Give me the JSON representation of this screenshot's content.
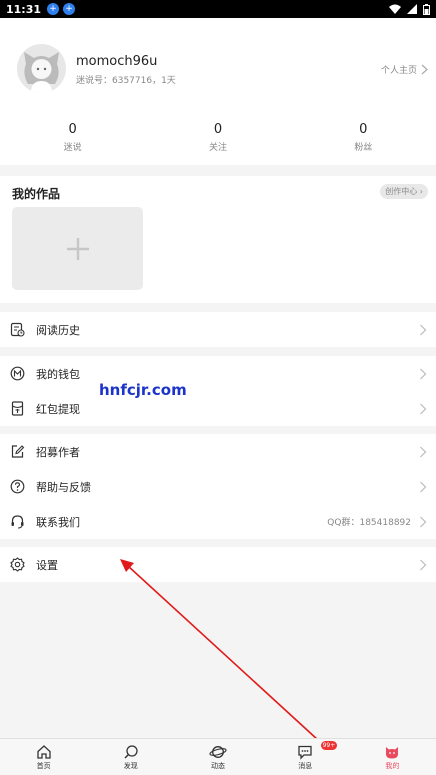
{
  "status": {
    "time": "11:31"
  },
  "profile": {
    "username": "momoch96u",
    "user_id": "迷说号：6357716，1天",
    "homepage_label": "个人主页",
    "stats": [
      {
        "value": "0",
        "label": "迷说"
      },
      {
        "value": "0",
        "label": "关注"
      },
      {
        "value": "0",
        "label": "粉丝"
      }
    ]
  },
  "works": {
    "title": "我的作品",
    "create_center": "创作中心"
  },
  "menu": {
    "reading_history": "阅读历史",
    "wallet": "我的钱包",
    "redpacket": "红包提现",
    "recruit": "招募作者",
    "help": "帮助与反馈",
    "contact": "联系我们",
    "contact_qq": "QQ群：185418892",
    "settings": "设置"
  },
  "watermark": "hnfcjr.com",
  "tabs": [
    {
      "label": "首页",
      "icon": "home-icon"
    },
    {
      "label": "发现",
      "icon": "discover-icon"
    },
    {
      "label": "动态",
      "icon": "planet-icon"
    },
    {
      "label": "消息",
      "icon": "message-icon",
      "badge": "99+"
    },
    {
      "label": "我的",
      "icon": "cat-icon",
      "active": true
    }
  ],
  "colors": {
    "accent": "#e84a5f",
    "annotation_arrow": "#e11b1b"
  }
}
